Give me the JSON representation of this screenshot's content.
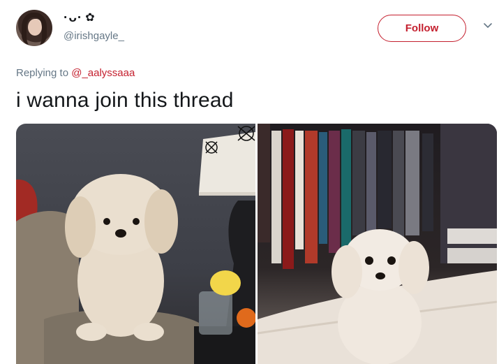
{
  "tweet": {
    "display_name": "·ᴗ·",
    "display_name_icon": "flower-icon",
    "handle": "@irishgayle_",
    "follow_label": "Follow",
    "reply_prefix": "Replying to",
    "reply_to": "@_aalyssaaa",
    "text": "i wanna join this thread"
  },
  "colors": {
    "accent": "#c41f2e",
    "secondary_text": "#657786",
    "primary_text": "#14171a"
  },
  "media": {
    "photos": [
      {
        "name": "dog-on-couch-photo"
      },
      {
        "name": "dog-on-bed-photo"
      }
    ]
  }
}
